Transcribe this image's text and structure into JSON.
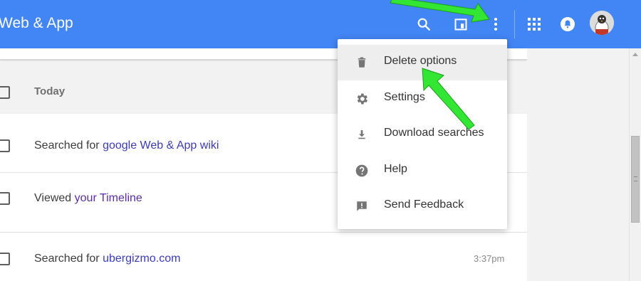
{
  "header": {
    "title": "Web & App",
    "icons": [
      "search-icon",
      "archive-icon",
      "more-vert-icon",
      "apps-icon",
      "notifications-icon"
    ]
  },
  "colors": {
    "header_bg": "#4285f4",
    "link": "#3b3bb8",
    "visited_link": "#5b2ca6",
    "annotation_arrow": "#33e633"
  },
  "list": {
    "section_label": "Today",
    "rows": [
      {
        "prefix": "Searched for ",
        "link": "google Web & App wiki",
        "time": ""
      },
      {
        "prefix": "Viewed ",
        "link": "your Timeline",
        "time": ""
      },
      {
        "prefix": "Searched for ",
        "link": "ubergizmo.com",
        "time": "3:37pm"
      }
    ]
  },
  "menu": {
    "items": [
      {
        "label": "Delete options",
        "icon": "trash-icon",
        "active": true
      },
      {
        "label": "Settings",
        "icon": "gear-icon",
        "active": false
      },
      {
        "label": "Download searches",
        "icon": "download-icon",
        "active": false
      },
      {
        "label": "Help",
        "icon": "help-icon",
        "active": false
      },
      {
        "label": "Send Feedback",
        "icon": "feedback-icon",
        "active": false
      }
    ]
  }
}
